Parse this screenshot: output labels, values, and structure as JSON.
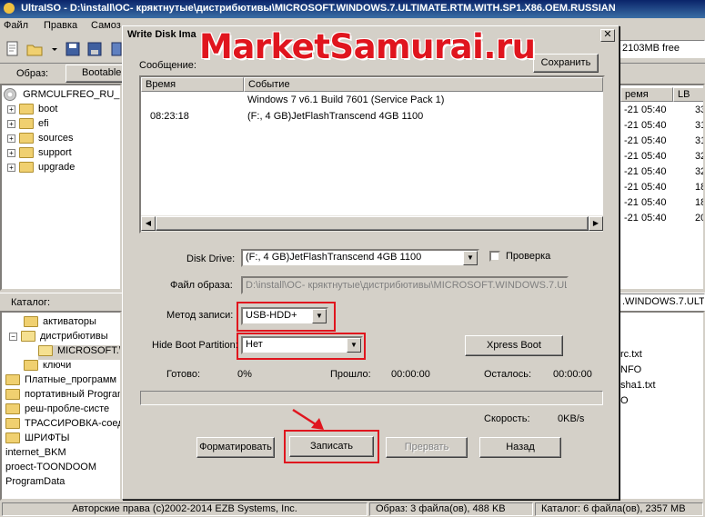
{
  "window": {
    "title": "UltraISO - D:\\install\\ОС- кряктнутые\\дистрибютивы\\MICROSOFT.WINDOWS.7.ULTIMATE.RTM.WITH.SP1.X86.OEM.RUSSIAN",
    "menu": [
      "Файл",
      "Правка",
      "Самоз"
    ],
    "free_space": "2103MB free",
    "image_label": "Образ:",
    "image_type": "Bootable"
  },
  "left_tree": {
    "root": "GRMCULFREO_RU_D",
    "items": [
      "boot",
      "efi",
      "sources",
      "support",
      "upgrade"
    ]
  },
  "catalog": {
    "label": "Каталог:",
    "path_right": ".WINDOWS.7.ULTI",
    "items": [
      {
        "label": "активаторы",
        "indent": 2
      },
      {
        "label": "дистрибютивы",
        "indent": 2
      },
      {
        "label": "MICROSOFT.\\",
        "indent": 3
      },
      {
        "label": "ключи",
        "indent": 2
      },
      {
        "label": "Платные_программ",
        "indent": 0
      },
      {
        "label": "портативный Program",
        "indent": 0
      },
      {
        "label": "реш-пробле-систе",
        "indent": 0
      },
      {
        "label": "ТРАССИРОВКА-соед",
        "indent": 0
      },
      {
        "label": "ШРИФТЫ",
        "indent": 0
      },
      {
        "label": "internet_BKM",
        "indent": 0
      },
      {
        "label": "proect-TOONDOOM",
        "indent": 0
      },
      {
        "label": "ProgramData",
        "indent": 0
      }
    ]
  },
  "right_list": {
    "headers": [
      "ремя",
      "LB"
    ],
    "rows": [
      [
        "-21 05:40",
        "33"
      ],
      [
        "-21 05:40",
        "31"
      ],
      [
        "-21 05:40",
        "31"
      ],
      [
        "-21 05:40",
        "32"
      ],
      [
        "-21 05:40",
        "32"
      ],
      [
        "-21 05:40",
        "18"
      ],
      [
        "-21 05:40",
        "18"
      ],
      [
        "-21 05:40",
        "20"
      ]
    ],
    "files": [
      "rc.txt",
      "NFO",
      "sha1.txt",
      "O"
    ]
  },
  "dialog": {
    "title": "Write Disk Ima",
    "message_label": "Сообщение:",
    "save_button": "Сохранить",
    "log_headers": [
      "Время",
      "Событие"
    ],
    "log_rows": [
      {
        "time": "",
        "event": "Windows 7 v6.1 Build 7601 (Service Pack 1)"
      },
      {
        "time": "08:23:18",
        "event": "(F:, 4 GB)JetFlashTranscend 4GB    1100"
      }
    ],
    "disk_drive_label": "Disk Drive:",
    "disk_drive_value": "(F:, 4 GB)JetFlashTranscend 4GB    1100",
    "verify_label": "Проверка",
    "image_file_label": "Файл образа:",
    "image_file_value": "D:\\install\\ОС- кряктнутые\\дистрибютивы\\MICROSOFT.WINDOWS.7.UL",
    "write_method_label": "Метод записи:",
    "write_method_value": "USB-HDD+",
    "hide_boot_label": "Hide Boot Partition:",
    "hide_boot_value": "Нет",
    "xpress_boot_button": "Xpress Boot",
    "done_label": "Готово:",
    "done_value": "0%",
    "elapsed_label": "Прошло:",
    "elapsed_value": "00:00:00",
    "remaining_label": "Осталось:",
    "remaining_value": "00:00:00",
    "progress": 0,
    "speed_label": "Скорость:",
    "speed_value": "0KB/s",
    "buttons": {
      "format": "Форматировать",
      "write": "Записать",
      "abort": "Прервать",
      "back": "Назад"
    }
  },
  "watermark": "MarketSamurai.ru",
  "status": {
    "copyright": "Авторские права (c)2002-2014 EZB Systems, Inc.",
    "image_info": "Образ: 3 файла(ов), 488 KB",
    "catalog_info": "Каталог: 6 файла(ов), 2357 MB"
  },
  "colors": {
    "highlight_red": "#e0151e",
    "title_blue": "#0a246a"
  }
}
